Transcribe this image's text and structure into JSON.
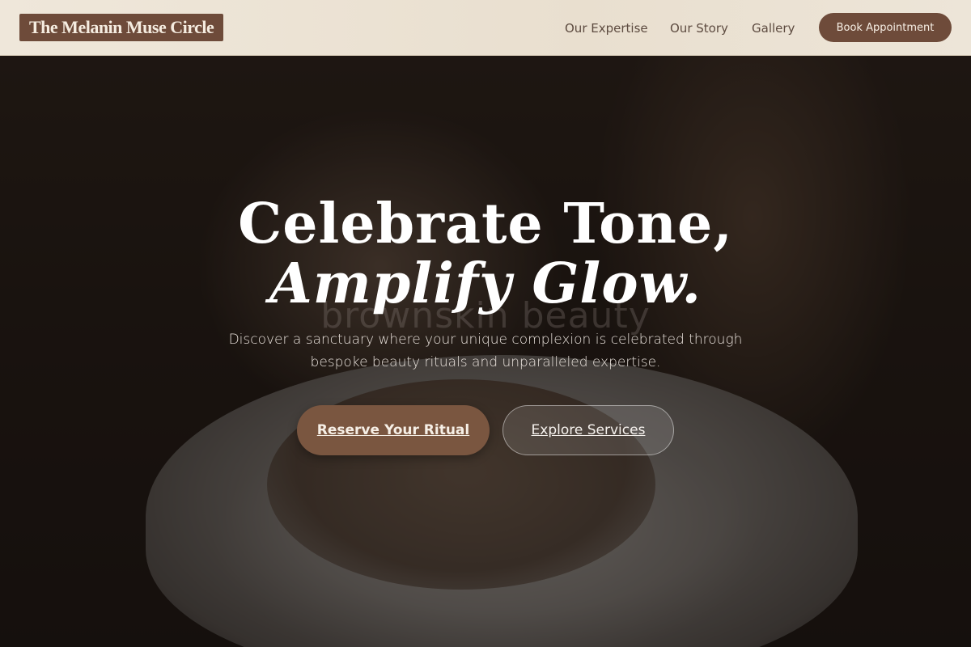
{
  "header": {
    "logo_text": "The Melanin Muse Circle",
    "nav": {
      "expertise": "Our Expertise",
      "story": "Our Story",
      "gallery": "Gallery"
    },
    "book_button": "Book Appointment"
  },
  "hero": {
    "watermark": "brownskin beauty",
    "headline_line1": "Celebrate Tone,",
    "headline_line2": "Amplify Glow.",
    "subtext": "Discover a sanctuary where your unique complexion is celebrated through bespoke beauty rituals and unparalleled expertise.",
    "primary_cta": "Reserve Your Ritual",
    "secondary_cta": "Explore Services"
  },
  "colors": {
    "brand_brown": "#6e4b3a",
    "cta_brown": "#7a5640",
    "header_bg": "#efe7da",
    "nav_text": "#5d4b40"
  }
}
